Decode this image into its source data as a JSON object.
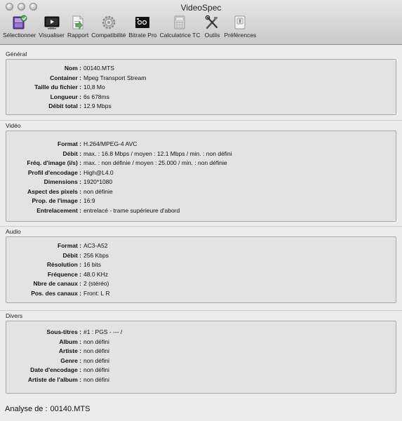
{
  "window": {
    "title": "VideoSpec"
  },
  "toolbar": [
    {
      "label": "Sélectionner",
      "icon": "film-icon"
    },
    {
      "label": "Visualiser",
      "icon": "monitor-icon"
    },
    {
      "label": "Rapport",
      "icon": "report-icon"
    },
    {
      "label": "Compatibilité",
      "icon": "gear-icon"
    },
    {
      "label": "Bitrate Pro",
      "icon": "bitrate-icon"
    },
    {
      "label": "Calculatrice TC",
      "icon": "calculator-icon"
    },
    {
      "label": "Outils",
      "icon": "tools-icon"
    },
    {
      "label": "Préférences",
      "icon": "preferences-icon"
    }
  ],
  "sections": {
    "general": {
      "label": "Général",
      "rows": [
        {
          "k": "Nom :",
          "v": "00140.MTS"
        },
        {
          "k": "Container :",
          "v": "Mpeg Transport Stream"
        },
        {
          "k": "Taille du fichier :",
          "v": "10,8 Mo"
        },
        {
          "k": "Longueur :",
          "v": "6s 678ms"
        },
        {
          "k": "Débit total :",
          "v": "12.9 Mbps"
        }
      ]
    },
    "video": {
      "label": "Vidéo",
      "rows": [
        {
          "k": "Format :",
          "v": "H.264/MPEG-4 AVC"
        },
        {
          "k": "Débit :",
          "v": "max. : 16.8 Mbps / moyen : 12.1 Mbps / min. : non défini"
        },
        {
          "k": "Fréq. d'image (i/s) :",
          "v": "max. : non définie / moyen : 25.000 / min. : non définie"
        },
        {
          "k": "Profil d'encodage :",
          "v": "High@L4.0"
        },
        {
          "k": "Dimensions :",
          "v": "1920*1080"
        },
        {
          "k": "Aspect des pixels :",
          "v": "non définie"
        },
        {
          "k": "Prop. de l'image :",
          "v": "16:9"
        },
        {
          "k": "Entrelacement :",
          "v": "entrelacé - trame supérieure d'abord"
        }
      ]
    },
    "audio": {
      "label": "Audio",
      "rows": [
        {
          "k": "Format :",
          "v": "AC3-A52"
        },
        {
          "k": "Débit :",
          "v": "256 Kbps"
        },
        {
          "k": "Résolution :",
          "v": "16 bits"
        },
        {
          "k": "Fréquence :",
          "v": "48.0 KHz"
        },
        {
          "k": "Nbre de canaux :",
          "v": "2 (stéréo)"
        },
        {
          "k": "Pos. des canaux :",
          "v": "Front: L R"
        }
      ]
    },
    "divers": {
      "label": "Divers",
      "rows": [
        {
          "k": "Sous-titres :",
          "v": "#1 : PGS - --- /"
        },
        {
          "k": "Album :",
          "v": "non défini"
        },
        {
          "k": "Artiste :",
          "v": "non défini"
        },
        {
          "k": "Genre :",
          "v": "non défini"
        },
        {
          "k": "Date d'encodage :",
          "v": "non défini"
        },
        {
          "k": "Artiste de l'album :",
          "v": "non défini"
        }
      ]
    }
  },
  "footer": {
    "label": "Analyse de :",
    "value": "00140.MTS"
  }
}
